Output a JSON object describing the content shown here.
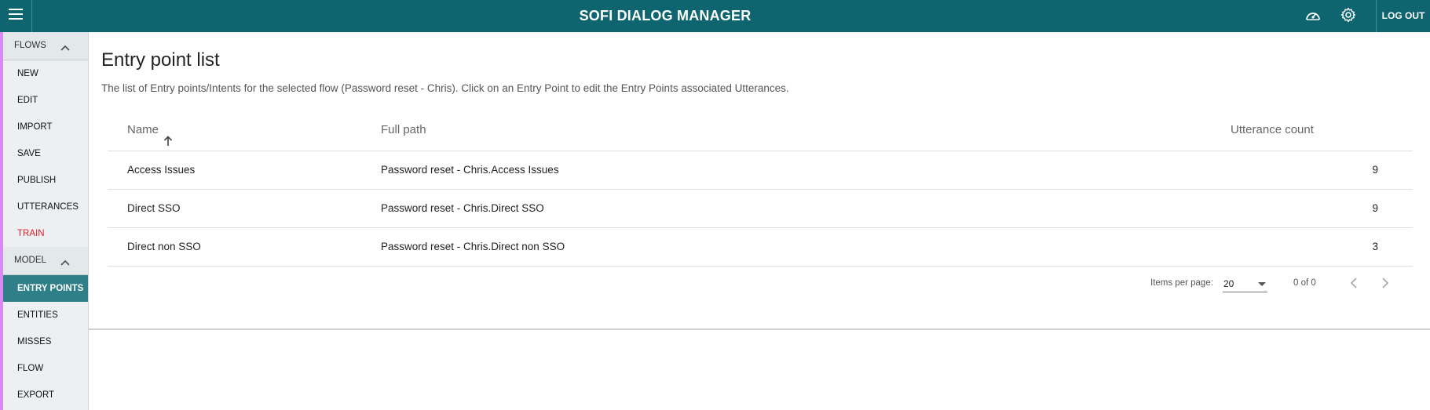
{
  "header": {
    "title": "SOFI DIALOG MANAGER",
    "logout_label": "LOG OUT",
    "icons": [
      "menu-icon",
      "dashboard-icon",
      "gear-icon"
    ]
  },
  "sidebar": {
    "flows_section": {
      "label": "FLOWS",
      "items": [
        {
          "label": "NEW"
        },
        {
          "label": "EDIT"
        },
        {
          "label": "IMPORT"
        },
        {
          "label": "SAVE"
        },
        {
          "label": "PUBLISH"
        },
        {
          "label": "UTTERANCES"
        },
        {
          "label": "TRAIN"
        }
      ]
    },
    "model_section": {
      "label": "MODEL",
      "items": [
        {
          "label": "ENTRY POINTS"
        },
        {
          "label": "ENTITIES"
        },
        {
          "label": "MISSES"
        },
        {
          "label": "FLOW"
        },
        {
          "label": "EXPORT"
        }
      ]
    },
    "active_item": "ENTRY POINTS"
  },
  "main": {
    "title": "Entry point list",
    "description": "The list of Entry points/Intents for the selected flow (Password reset - Chris). Click on an Entry Point to edit the Entry Points associated Utterances.",
    "table": {
      "columns": [
        "Name",
        "Full path",
        "Utterance count"
      ],
      "rows": [
        {
          "name": "Access Issues",
          "path": "Password reset - Chris.Access Issues",
          "count": "9"
        },
        {
          "name": "Direct SSO",
          "path": "Password reset - Chris.Direct SSO",
          "count": "9"
        },
        {
          "name": "Direct non SSO",
          "path": "Password reset - Chris.Direct non SSO",
          "count": "3"
        }
      ]
    },
    "paginator": {
      "items_per_page_label": "Items per page:",
      "items_per_page_value": "20",
      "range_label": "0 of 0"
    }
  },
  "colors": {
    "header_bg": "#0e6570",
    "active_item_bg": "#2f7f88",
    "train_text": "#e0202a",
    "sidebar_accent": "#d98af0"
  }
}
